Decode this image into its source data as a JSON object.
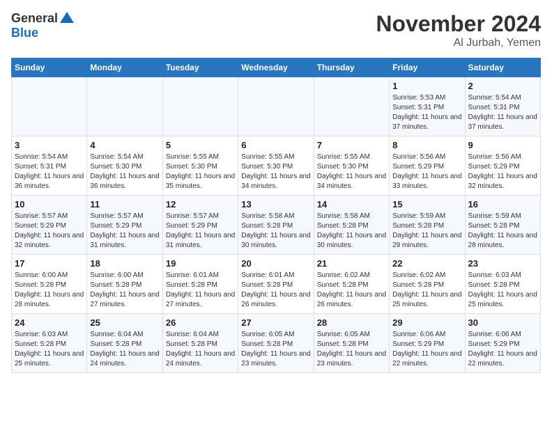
{
  "header": {
    "logo_general": "General",
    "logo_blue": "Blue",
    "month_title": "November 2024",
    "location": "Al Jurbah, Yemen"
  },
  "days_of_week": [
    "Sunday",
    "Monday",
    "Tuesday",
    "Wednesday",
    "Thursday",
    "Friday",
    "Saturday"
  ],
  "weeks": [
    [
      {
        "day": "",
        "info": ""
      },
      {
        "day": "",
        "info": ""
      },
      {
        "day": "",
        "info": ""
      },
      {
        "day": "",
        "info": ""
      },
      {
        "day": "",
        "info": ""
      },
      {
        "day": "1",
        "info": "Sunrise: 5:53 AM\nSunset: 5:31 PM\nDaylight: 11 hours and 37 minutes."
      },
      {
        "day": "2",
        "info": "Sunrise: 5:54 AM\nSunset: 5:31 PM\nDaylight: 11 hours and 37 minutes."
      }
    ],
    [
      {
        "day": "3",
        "info": "Sunrise: 5:54 AM\nSunset: 5:31 PM\nDaylight: 11 hours and 36 minutes."
      },
      {
        "day": "4",
        "info": "Sunrise: 5:54 AM\nSunset: 5:30 PM\nDaylight: 11 hours and 36 minutes."
      },
      {
        "day": "5",
        "info": "Sunrise: 5:55 AM\nSunset: 5:30 PM\nDaylight: 11 hours and 35 minutes."
      },
      {
        "day": "6",
        "info": "Sunrise: 5:55 AM\nSunset: 5:30 PM\nDaylight: 11 hours and 34 minutes."
      },
      {
        "day": "7",
        "info": "Sunrise: 5:55 AM\nSunset: 5:30 PM\nDaylight: 11 hours and 34 minutes."
      },
      {
        "day": "8",
        "info": "Sunrise: 5:56 AM\nSunset: 5:29 PM\nDaylight: 11 hours and 33 minutes."
      },
      {
        "day": "9",
        "info": "Sunrise: 5:56 AM\nSunset: 5:29 PM\nDaylight: 11 hours and 32 minutes."
      }
    ],
    [
      {
        "day": "10",
        "info": "Sunrise: 5:57 AM\nSunset: 5:29 PM\nDaylight: 11 hours and 32 minutes."
      },
      {
        "day": "11",
        "info": "Sunrise: 5:57 AM\nSunset: 5:29 PM\nDaylight: 11 hours and 31 minutes."
      },
      {
        "day": "12",
        "info": "Sunrise: 5:57 AM\nSunset: 5:29 PM\nDaylight: 11 hours and 31 minutes."
      },
      {
        "day": "13",
        "info": "Sunrise: 5:58 AM\nSunset: 5:28 PM\nDaylight: 11 hours and 30 minutes."
      },
      {
        "day": "14",
        "info": "Sunrise: 5:58 AM\nSunset: 5:28 PM\nDaylight: 11 hours and 30 minutes."
      },
      {
        "day": "15",
        "info": "Sunrise: 5:59 AM\nSunset: 5:28 PM\nDaylight: 11 hours and 29 minutes."
      },
      {
        "day": "16",
        "info": "Sunrise: 5:59 AM\nSunset: 5:28 PM\nDaylight: 11 hours and 28 minutes."
      }
    ],
    [
      {
        "day": "17",
        "info": "Sunrise: 6:00 AM\nSunset: 5:28 PM\nDaylight: 11 hours and 28 minutes."
      },
      {
        "day": "18",
        "info": "Sunrise: 6:00 AM\nSunset: 5:28 PM\nDaylight: 11 hours and 27 minutes."
      },
      {
        "day": "19",
        "info": "Sunrise: 6:01 AM\nSunset: 5:28 PM\nDaylight: 11 hours and 27 minutes."
      },
      {
        "day": "20",
        "info": "Sunrise: 6:01 AM\nSunset: 5:28 PM\nDaylight: 11 hours and 26 minutes."
      },
      {
        "day": "21",
        "info": "Sunrise: 6:02 AM\nSunset: 5:28 PM\nDaylight: 11 hours and 26 minutes."
      },
      {
        "day": "22",
        "info": "Sunrise: 6:02 AM\nSunset: 5:28 PM\nDaylight: 11 hours and 25 minutes."
      },
      {
        "day": "23",
        "info": "Sunrise: 6:03 AM\nSunset: 5:28 PM\nDaylight: 11 hours and 25 minutes."
      }
    ],
    [
      {
        "day": "24",
        "info": "Sunrise: 6:03 AM\nSunset: 5:28 PM\nDaylight: 11 hours and 25 minutes."
      },
      {
        "day": "25",
        "info": "Sunrise: 6:04 AM\nSunset: 5:28 PM\nDaylight: 11 hours and 24 minutes."
      },
      {
        "day": "26",
        "info": "Sunrise: 6:04 AM\nSunset: 5:28 PM\nDaylight: 11 hours and 24 minutes."
      },
      {
        "day": "27",
        "info": "Sunrise: 6:05 AM\nSunset: 5:28 PM\nDaylight: 11 hours and 23 minutes."
      },
      {
        "day": "28",
        "info": "Sunrise: 6:05 AM\nSunset: 5:28 PM\nDaylight: 11 hours and 23 minutes."
      },
      {
        "day": "29",
        "info": "Sunrise: 6:06 AM\nSunset: 5:29 PM\nDaylight: 11 hours and 22 minutes."
      },
      {
        "day": "30",
        "info": "Sunrise: 6:06 AM\nSunset: 5:29 PM\nDaylight: 11 hours and 22 minutes."
      }
    ]
  ]
}
